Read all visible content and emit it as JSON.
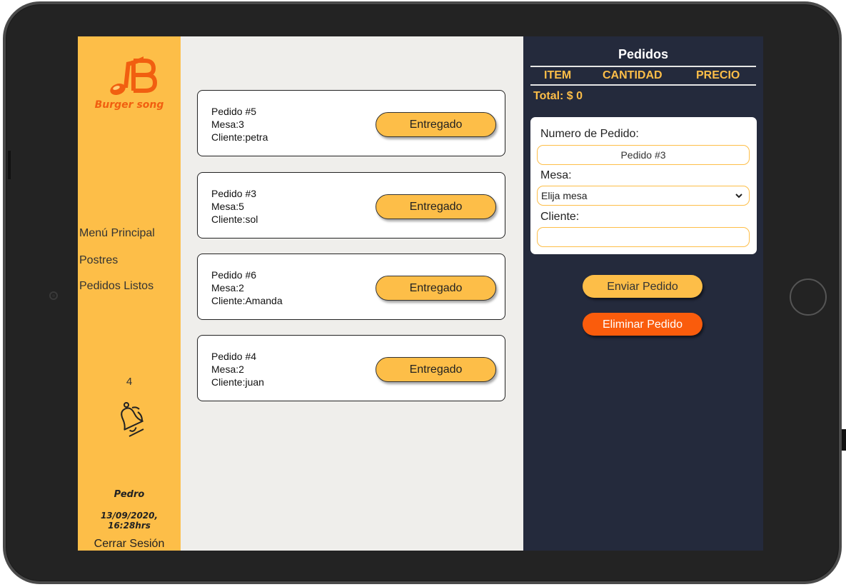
{
  "brand": {
    "name": "Burger song"
  },
  "sidebar": {
    "items": [
      {
        "label": "Menú Principal"
      },
      {
        "label": "Postres"
      },
      {
        "label": "Pedidos Listos"
      }
    ],
    "notification_count": "4",
    "user_name": "Pedro",
    "datetime": "13/09/2020, 16:28hrs",
    "logout_label": "Cerrar Sesión"
  },
  "orders": [
    {
      "title": "Pedido #5",
      "mesa": "Mesa:3",
      "cliente": "Cliente:petra",
      "button": "Entregado"
    },
    {
      "title": "Pedido #3",
      "mesa": "Mesa:5",
      "cliente": "Cliente:sol",
      "button": "Entregado"
    },
    {
      "title": "Pedido #6",
      "mesa": "Mesa:2",
      "cliente": "Cliente:Amanda",
      "button": "Entregado"
    },
    {
      "title": "Pedido #4",
      "mesa": "Mesa:2",
      "cliente": "Cliente:juan",
      "button": "Entregado"
    }
  ],
  "panel": {
    "title": "Pedidos",
    "columns": [
      "ITEM",
      "CANTIDAD",
      "PRECIO"
    ],
    "total": "Total: $ 0",
    "form": {
      "order_number_label": "Numero de Pedido:",
      "order_number_value": "Pedido #3",
      "table_label": "Mesa:",
      "table_selected": "Elija mesa",
      "client_label": "Cliente:",
      "client_value": ""
    },
    "send_label": "Enviar Pedido",
    "delete_label": "Eliminar Pedido"
  },
  "colors": {
    "accent": "#fdbe48",
    "brand_orange": "#f15f10",
    "panel_bg": "#242a3c",
    "danger": "#fa5c0c"
  }
}
